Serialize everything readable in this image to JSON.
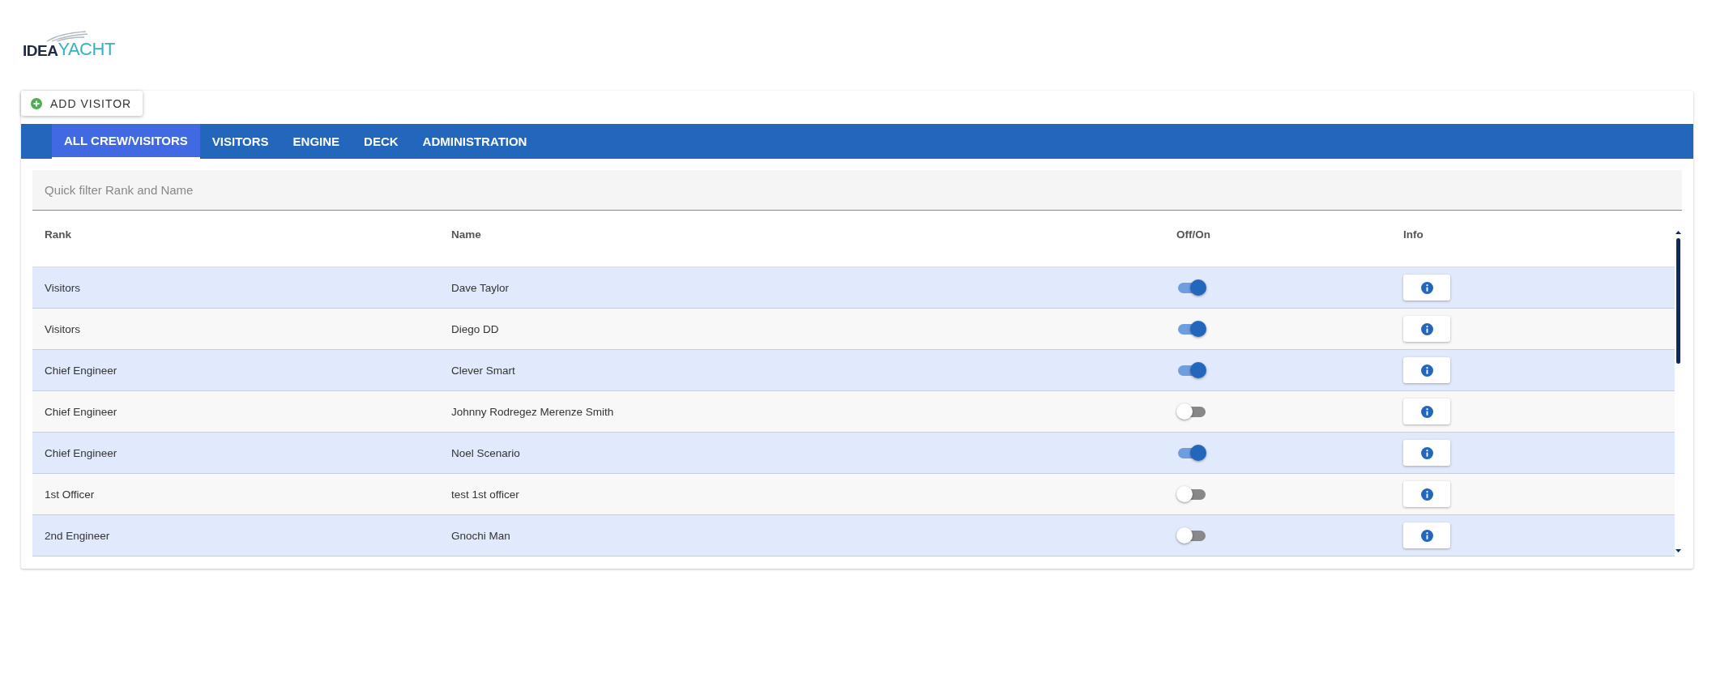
{
  "logo": {
    "parts": [
      "IDEA",
      "YACHT"
    ]
  },
  "add_button": {
    "label": "ADD VISITOR"
  },
  "tabs": [
    {
      "label": "ALL CREW/VISITORS",
      "selected": true
    },
    {
      "label": "VISITORS",
      "selected": false
    },
    {
      "label": "ENGINE",
      "selected": false
    },
    {
      "label": "DECK",
      "selected": false
    },
    {
      "label": "ADMINISTRATION",
      "selected": false
    }
  ],
  "filter": {
    "placeholder": "Quick filter Rank and Name"
  },
  "table": {
    "columns": [
      "Rank",
      "Name",
      "Off/On",
      "Info"
    ],
    "rows": [
      {
        "rank": "Visitors",
        "name": "Dave Taylor",
        "on": true
      },
      {
        "rank": "Visitors",
        "name": "Diego DD",
        "on": true
      },
      {
        "rank": "Chief Engineer",
        "name": "Clever Smart",
        "on": true
      },
      {
        "rank": "Chief Engineer",
        "name": "Johnny Rodregez Merenze Smith",
        "on": false
      },
      {
        "rank": "Chief Engineer",
        "name": "Noel Scenario",
        "on": true
      },
      {
        "rank": "1st Officer",
        "name": "test 1st officer",
        "on": false
      },
      {
        "rank": "2nd Engineer",
        "name": "Gnochi Man",
        "on": false
      }
    ]
  }
}
